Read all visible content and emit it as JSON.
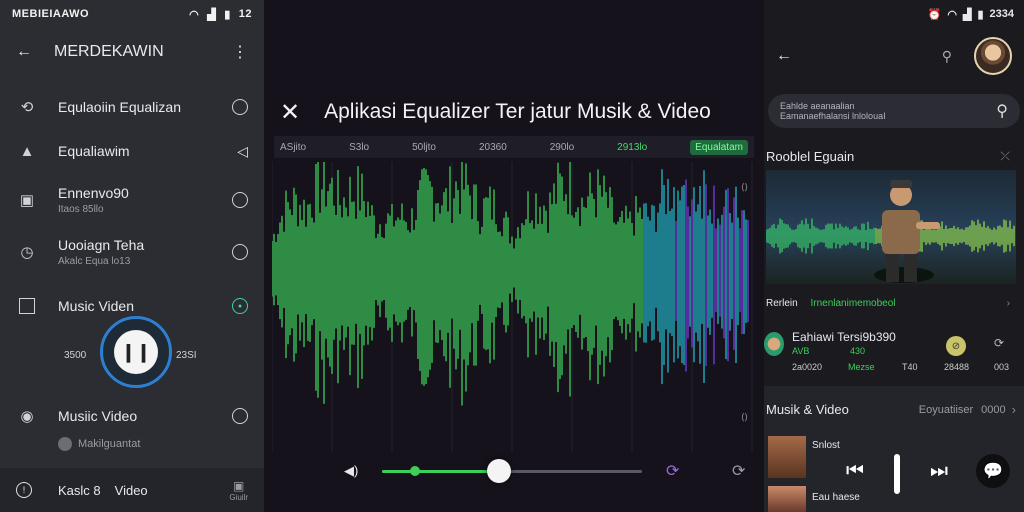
{
  "left": {
    "status_time": "MEBIEIAAWO",
    "status_right": "12",
    "title": "MERDEKAWIN",
    "items": [
      {
        "label": "Equlaoiin Equalizan",
        "sub": ""
      },
      {
        "label": "Equaliawim",
        "sub": ""
      },
      {
        "label": "Ennenvo90",
        "sub": "Itaos 85llo"
      },
      {
        "label": "Uooiagn Teha",
        "sub": "Akalc Equa lo13"
      },
      {
        "label": "Music Viden",
        "sub": ""
      },
      {
        "label": "Musiic Video",
        "sub": "Makilguantat"
      }
    ],
    "time_left": "3500",
    "time_right": "23SI",
    "footer_label": "Kaslc 8",
    "footer_label2": "Video",
    "footer_right": "Giuilr"
  },
  "middle": {
    "title": "Aplikasi Equalizer Ter  jatur Musik & Video",
    "tabs": [
      "ASjito",
      "S3lo",
      "50ljto",
      "20360",
      "290lo",
      "2913lo",
      "Equalatam"
    ],
    "slider_value": 0.45,
    "colors": {
      "wave_green": "#3ccf5a",
      "wave_cyan": "#23b7c9",
      "wave_purple": "#7b3fe0"
    }
  },
  "right": {
    "status_time": "2334",
    "search_line1": "Eahlde aeanaalian",
    "search_line2": "Eamanaefhalansi lnlolouaI",
    "section1_title": "Rooblel Eguain",
    "row1_label": "Rerlein",
    "row1_value": "Irnenlanimemobeol",
    "card": {
      "title": "Eahiawi Tersi9b390",
      "meta1": "AVB",
      "meta2": "430",
      "stats": [
        "2a0020",
        "Mezse",
        "T40",
        "28488",
        "003"
      ]
    },
    "section2_title": "Musik & Video",
    "section2_right": "Eoyuatiiser",
    "section2_right2": "0000",
    "player_track1": "Snlost",
    "player_track2": "Eau haese"
  }
}
